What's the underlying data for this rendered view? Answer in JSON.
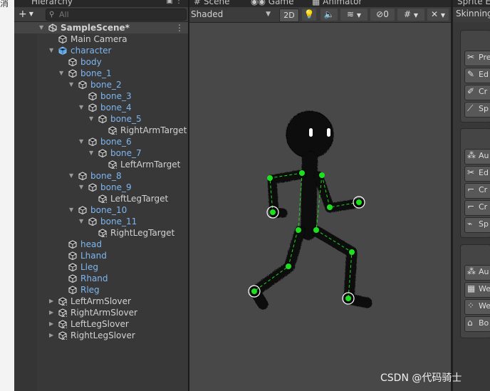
{
  "left_strip": {
    "glyph": "消"
  },
  "hierarchy": {
    "tab_label": "Hierarchy",
    "search_placeholder": "All",
    "add_label": "+",
    "scene_name": "SampleScene*",
    "items": [
      {
        "label": "Main Camera",
        "depth": 1,
        "arrow": "",
        "color": "white",
        "icon": "cube-icon"
      },
      {
        "label": "character",
        "depth": 1,
        "arrow": "down",
        "color": "blue",
        "icon": "prefab-cube-icon"
      },
      {
        "label": "body",
        "depth": 2,
        "arrow": "",
        "color": "blue",
        "icon": "cube-icon"
      },
      {
        "label": "bone_1",
        "depth": 2,
        "arrow": "down",
        "color": "blue",
        "icon": "cube-icon"
      },
      {
        "label": "bone_2",
        "depth": 3,
        "arrow": "down",
        "color": "blue",
        "icon": "cube-icon"
      },
      {
        "label": "bone_3",
        "depth": 4,
        "arrow": "",
        "color": "blue",
        "icon": "cube-icon"
      },
      {
        "label": "bone_4",
        "depth": 4,
        "arrow": "down",
        "color": "blue",
        "icon": "cube-icon"
      },
      {
        "label": "bone_5",
        "depth": 5,
        "arrow": "down",
        "color": "blue",
        "icon": "cube-icon"
      },
      {
        "label": "RightArmTarget",
        "depth": 6,
        "arrow": "",
        "color": "white",
        "icon": "gear-cube-icon"
      },
      {
        "label": "bone_6",
        "depth": 4,
        "arrow": "down",
        "color": "blue",
        "icon": "cube-icon"
      },
      {
        "label": "bone_7",
        "depth": 5,
        "arrow": "down",
        "color": "blue",
        "icon": "cube-icon"
      },
      {
        "label": "LeftArmTarget",
        "depth": 6,
        "arrow": "",
        "color": "white",
        "icon": "gear-cube-icon"
      },
      {
        "label": "bone_8",
        "depth": 3,
        "arrow": "down",
        "color": "blue",
        "icon": "cube-icon"
      },
      {
        "label": "bone_9",
        "depth": 4,
        "arrow": "down",
        "color": "blue",
        "icon": "cube-icon"
      },
      {
        "label": "LeftLegTarget",
        "depth": 5,
        "arrow": "",
        "color": "white",
        "icon": "gear-cube-icon"
      },
      {
        "label": "bone_10",
        "depth": 3,
        "arrow": "down",
        "color": "blue",
        "icon": "cube-icon"
      },
      {
        "label": "bone_11",
        "depth": 4,
        "arrow": "down",
        "color": "blue",
        "icon": "cube-icon"
      },
      {
        "label": "RightLegTarget",
        "depth": 5,
        "arrow": "",
        "color": "white",
        "icon": "gear-cube-icon"
      },
      {
        "label": "head",
        "depth": 2,
        "arrow": "",
        "color": "blue",
        "icon": "cube-icon"
      },
      {
        "label": "Lhand",
        "depth": 2,
        "arrow": "",
        "color": "blue",
        "icon": "cube-icon"
      },
      {
        "label": "Lleg",
        "depth": 2,
        "arrow": "",
        "color": "blue",
        "icon": "cube-icon"
      },
      {
        "label": "Rhand",
        "depth": 2,
        "arrow": "",
        "color": "blue",
        "icon": "cube-icon"
      },
      {
        "label": "Rleg",
        "depth": 2,
        "arrow": "",
        "color": "blue",
        "icon": "cube-icon"
      },
      {
        "label": "LeftArmSlover",
        "depth": 1,
        "arrow": "right",
        "color": "white",
        "icon": "gear-cube-icon"
      },
      {
        "label": "RightArmSlover",
        "depth": 1,
        "arrow": "right",
        "color": "white",
        "icon": "gear-cube-icon"
      },
      {
        "label": "LeftLegSlover",
        "depth": 1,
        "arrow": "right",
        "color": "white",
        "icon": "gear-cube-icon"
      },
      {
        "label": "RightLegSlover",
        "depth": 1,
        "arrow": "right",
        "color": "white",
        "icon": "gear-cube-icon"
      }
    ]
  },
  "scene_view": {
    "tabs": [
      "Scene",
      "Game",
      "Animator"
    ],
    "shading_mode": "Shaded",
    "mode_2d": "2D",
    "hidden_count": "0"
  },
  "sprite_editor": {
    "tab_label": "Sprite Ed",
    "toolbar_label": "Skinning",
    "tools": [
      {
        "label": "Pre",
        "icon": "scissors-icon"
      },
      {
        "label": "Ed",
        "icon": "edit-bone-icon"
      },
      {
        "label": "Cr",
        "icon": "create-bone-icon"
      },
      {
        "label": "Sp",
        "icon": "split-bone-icon"
      },
      {
        "label": "Au",
        "icon": "auto-geometry-icon"
      },
      {
        "label": "Ed",
        "icon": "edit-geometry-icon"
      },
      {
        "label": "Cr",
        "icon": "create-vertex-icon"
      },
      {
        "label": "Cr",
        "icon": "create-edge-icon"
      },
      {
        "label": "Sp",
        "icon": "split-edge-icon"
      },
      {
        "label": "Au",
        "icon": "auto-weights-icon"
      },
      {
        "label": "We",
        "icon": "weight-slider-icon"
      },
      {
        "label": "We",
        "icon": "weight-brush-icon"
      },
      {
        "label": "Bo",
        "icon": "bone-influence-icon"
      }
    ]
  },
  "watermark": "CSDN @代码骑士"
}
